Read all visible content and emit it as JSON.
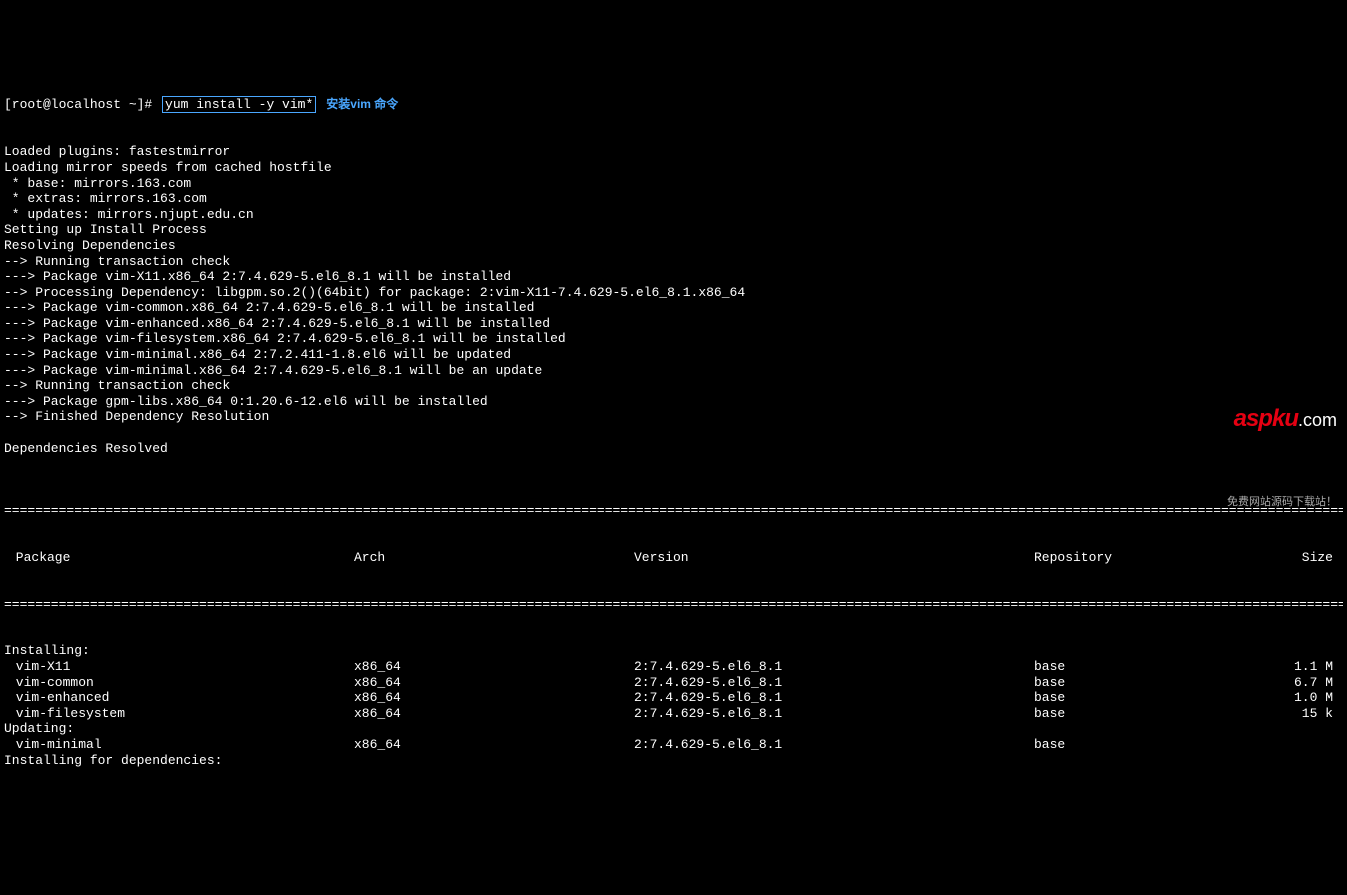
{
  "prompt": "[root@localhost ~]# ",
  "command": "yum install -y vim*",
  "annotation": "安装vim 命令",
  "output_lines": [
    "Loaded plugins: fastestmirror",
    "Loading mirror speeds from cached hostfile",
    " * base: mirrors.163.com",
    " * extras: mirrors.163.com",
    " * updates: mirrors.njupt.edu.cn",
    "Setting up Install Process",
    "Resolving Dependencies",
    "--> Running transaction check",
    "---> Package vim-X11.x86_64 2:7.4.629-5.el6_8.1 will be installed",
    "--> Processing Dependency: libgpm.so.2()(64bit) for package: 2:vim-X11-7.4.629-5.el6_8.1.x86_64",
    "---> Package vim-common.x86_64 2:7.4.629-5.el6_8.1 will be installed",
    "---> Package vim-enhanced.x86_64 2:7.4.629-5.el6_8.1 will be installed",
    "---> Package vim-filesystem.x86_64 2:7.4.629-5.el6_8.1 will be installed",
    "---> Package vim-minimal.x86_64 2:7.2.411-1.8.el6 will be updated",
    "---> Package vim-minimal.x86_64 2:7.4.629-5.el6_8.1 will be an update",
    "--> Running transaction check",
    "---> Package gpm-libs.x86_64 0:1.20.6-12.el6 will be installed",
    "--> Finished Dependency Resolution",
    "",
    "Dependencies Resolved",
    ""
  ],
  "table": {
    "headers": {
      "package": " Package",
      "arch": "Arch",
      "version": "Version",
      "repo": "Repository",
      "size": "Size"
    },
    "sections": [
      {
        "title": "Installing:",
        "rows": [
          {
            "package": " vim-X11",
            "arch": "x86_64",
            "version": "2:7.4.629-5.el6_8.1",
            "repo": "base",
            "size": "1.1 M"
          },
          {
            "package": " vim-common",
            "arch": "x86_64",
            "version": "2:7.4.629-5.el6_8.1",
            "repo": "base",
            "size": "6.7 M"
          },
          {
            "package": " vim-enhanced",
            "arch": "x86_64",
            "version": "2:7.4.629-5.el6_8.1",
            "repo": "base",
            "size": "1.0 M"
          },
          {
            "package": " vim-filesystem",
            "arch": "x86_64",
            "version": "2:7.4.629-5.el6_8.1",
            "repo": "base",
            "size": "15 k"
          }
        ]
      },
      {
        "title": "Updating:",
        "rows": [
          {
            "package": " vim-minimal",
            "arch": "x86_64",
            "version": "2:7.4.629-5.el6_8.1",
            "repo": "base",
            "size": ""
          }
        ]
      }
    ],
    "footer": "Installing for dependencies:"
  },
  "watermark": {
    "logo_red": "aspku",
    "logo_white": ".com",
    "subtitle": "免费网站源码下载站！"
  },
  "divider": "====================================================================================================================================================================================="
}
